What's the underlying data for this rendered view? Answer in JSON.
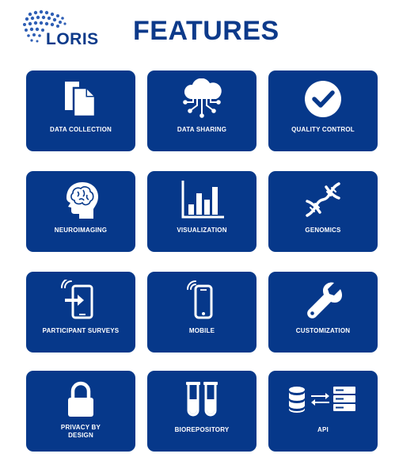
{
  "header": {
    "logo_text": "LORIS",
    "title": "FEATURES"
  },
  "colors": {
    "brand_blue": "#0d3a8a",
    "tile_blue": "#06388a",
    "tile_text": "#ffffff"
  },
  "tiles": [
    {
      "label": "DATA COLLECTION",
      "icon": "documents-icon"
    },
    {
      "label": "DATA SHARING",
      "icon": "cloud-network-icon"
    },
    {
      "label": "QUALITY CONTROL",
      "icon": "checkmark-circle-icon"
    },
    {
      "label": "NEUROIMAGING",
      "icon": "brain-head-icon"
    },
    {
      "label": "VISUALIZATION",
      "icon": "bar-chart-icon"
    },
    {
      "label": "GENOMICS",
      "icon": "dna-icon"
    },
    {
      "label": "PARTICIPANT SURVEYS",
      "icon": "tablet-login-icon"
    },
    {
      "label": "MOBILE",
      "icon": "smartphone-wireless-icon"
    },
    {
      "label": "CUSTOMIZATION",
      "icon": "wrench-icon"
    },
    {
      "label_line1": "PRIVACY BY",
      "label_line2": "DESIGN",
      "icon": "padlock-icon"
    },
    {
      "label": "BIOREPOSITORY",
      "icon": "test-tubes-icon"
    },
    {
      "label": "API",
      "icon": "database-server-exchange-icon"
    }
  ]
}
